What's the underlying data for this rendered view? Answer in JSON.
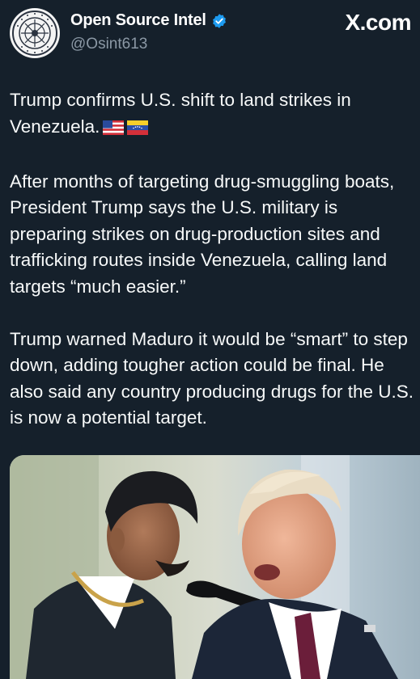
{
  "post": {
    "author": {
      "display_name": "Open Source Intel",
      "handle": "@Osint613",
      "verified": true,
      "avatar_icon": "osint-seal-logo",
      "avatar_text": "OPEN SOURCE INTEL"
    },
    "brand": "X.com",
    "headline": "Trump confirms U.S. shift to land strikes in Venezuela.",
    "headline_flags": [
      "us-flag-icon",
      "venezuela-flag-icon"
    ],
    "paragraphs": [
      "After months of targeting drug-smuggling boats, President Trump says the U.S. military is preparing strikes on drug-production sites and trafficking routes inside Venezuela, calling land targets “much easier.”",
      "Trump warned Maduro it would be “smart” to step down, adding tougher action could be final. He also said any country producing drugs for the U.S. is now a potential target."
    ],
    "media": {
      "type": "photo",
      "subjects": [
        "maduro-speaking-at-microphone",
        "trump-speaking"
      ]
    }
  },
  "colors": {
    "background": "#15202b",
    "text": "#f7f9f9",
    "secondary_text": "#8b98a5",
    "verified_blue": "#1d9bf0"
  }
}
